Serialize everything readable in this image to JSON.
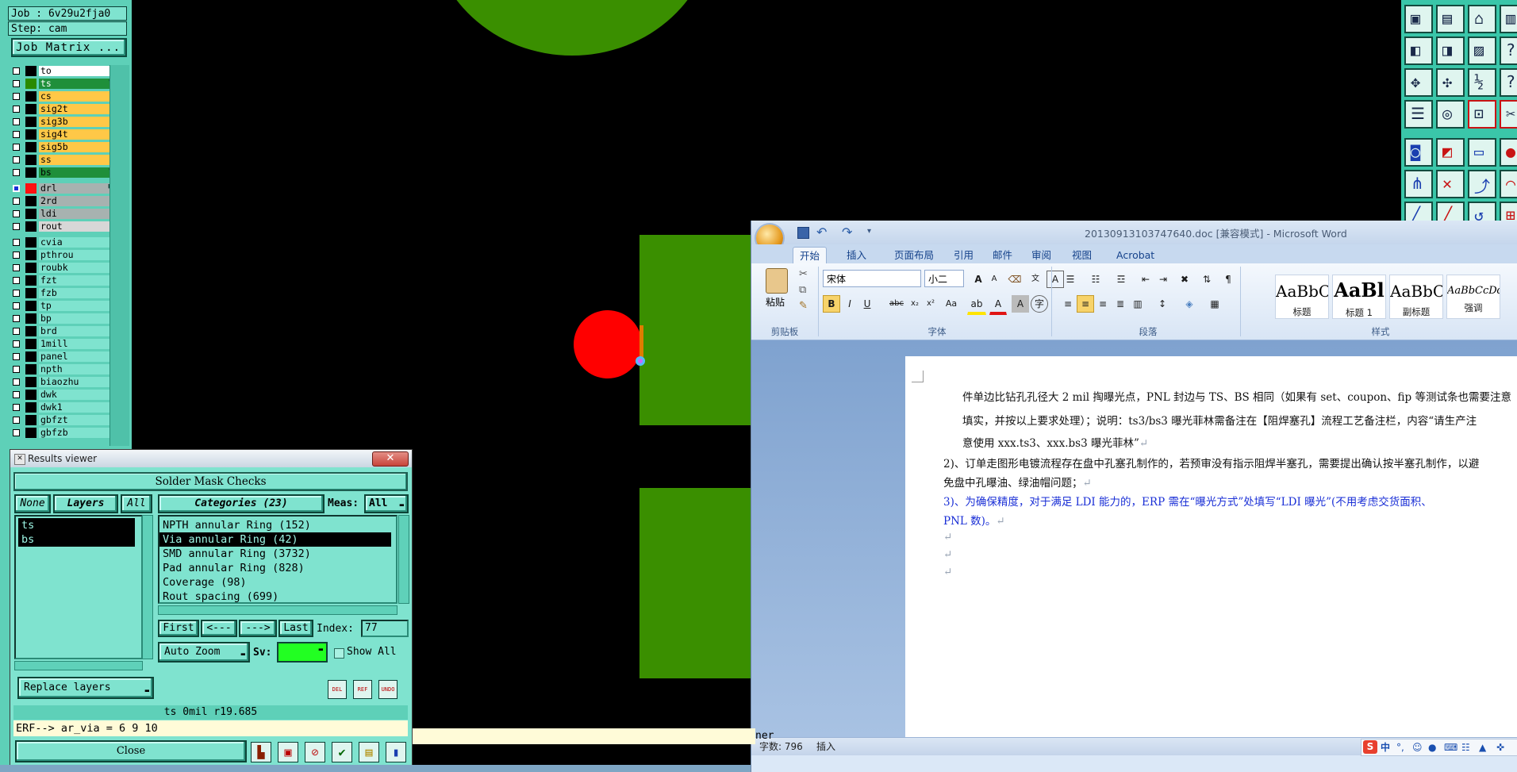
{
  "cam": {
    "job_label": "Job : 6v29u2fja0",
    "step_label": "Step: cam",
    "job_matrix_button": "Job Matrix ...",
    "layers": [
      {
        "name": "to",
        "color": "#ffffff",
        "swatch": "#000000"
      },
      {
        "name": "ts",
        "color": "#1f8f3a",
        "swatch": "#2a8a00",
        "active": true,
        "mark": "✎"
      },
      {
        "name": "cs",
        "color": "#ffc847",
        "swatch": "#000000"
      },
      {
        "name": "sig2t",
        "color": "#ffc847",
        "swatch": "#000000"
      },
      {
        "name": "sig3b",
        "color": "#ffc847",
        "swatch": "#000000"
      },
      {
        "name": "sig4t",
        "color": "#ffc847",
        "swatch": "#000000"
      },
      {
        "name": "sig5b",
        "color": "#ffc847",
        "swatch": "#000000"
      },
      {
        "name": "ss",
        "color": "#ffc847",
        "swatch": "#000000"
      },
      {
        "name": "bs",
        "color": "#1f8f3a",
        "swatch": "#000000",
        "mark": "✎"
      },
      {
        "name": "drl",
        "color": "#a7b2b0",
        "swatch": "#ff1111",
        "checked": true,
        "gap": true,
        "mark": "■"
      },
      {
        "name": "2rd",
        "color": "#a7b2b0",
        "swatch": "#000000"
      },
      {
        "name": "ldi",
        "color": "#a7b2b0",
        "swatch": "#000000"
      },
      {
        "name": "rout",
        "color": "#d7d7d7",
        "swatch": "#000000"
      },
      {
        "name": "cvia",
        "color": "#7fe3cf",
        "swatch": "#000000",
        "gap": true
      },
      {
        "name": "pthrou",
        "color": "#7fe3cf",
        "swatch": "#000000"
      },
      {
        "name": "roubk",
        "color": "#7fe3cf",
        "swatch": "#000000"
      },
      {
        "name": "fzt",
        "color": "#7fe3cf",
        "swatch": "#000000"
      },
      {
        "name": "fzb",
        "color": "#7fe3cf",
        "swatch": "#000000"
      },
      {
        "name": "tp",
        "color": "#7fe3cf",
        "swatch": "#000000"
      },
      {
        "name": "bp",
        "color": "#7fe3cf",
        "swatch": "#000000"
      },
      {
        "name": "brd",
        "color": "#7fe3cf",
        "swatch": "#000000"
      },
      {
        "name": "1mill",
        "color": "#7fe3cf",
        "swatch": "#000000"
      },
      {
        "name": "panel",
        "color": "#7fe3cf",
        "swatch": "#000000"
      },
      {
        "name": "npth",
        "color": "#7fe3cf",
        "swatch": "#000000"
      },
      {
        "name": "biaozhu",
        "color": "#7fe3cf",
        "swatch": "#000000"
      },
      {
        "name": "dwk",
        "color": "#7fe3cf",
        "swatch": "#000000"
      },
      {
        "name": "dwk1",
        "color": "#7fe3cf",
        "swatch": "#000000"
      },
      {
        "name": "gbfzt",
        "color": "#7fe3cf",
        "swatch": "#000000"
      },
      {
        "name": "gbfzb",
        "color": "#7fe3cf",
        "swatch": "#000000"
      }
    ],
    "status_text": "ts 0mil   r19.685",
    "command_line": "ERF--> ar_via = 6 9 10",
    "status_tail": "ner"
  },
  "results_viewer": {
    "window_title": "Results viewer",
    "close_x": "✕",
    "header": "Solder Mask Checks",
    "none_btn": "None",
    "layers_label": "Layers",
    "all_btn": "All",
    "categories_label": "Categories (23)",
    "meas_label": "Meas:",
    "meas_value": "All",
    "layer_items": [
      "ts",
      "bs"
    ],
    "category_items": [
      "NPTH annular Ring (152)",
      "Via annular Ring (42)",
      "SMD annular Ring (3732)",
      "Pad annular Ring (828)",
      "Coverage (98)",
      "Rout spacing (699)"
    ],
    "selected_category": 1,
    "first_btn": "First",
    "prev_btn": "<---",
    "next_btn": "--->",
    "last_btn": "Last",
    "index_label": "Index:",
    "index_value": "77",
    "auto_zoom": "Auto Zoom",
    "sv_label": "Sv:",
    "show_all_label": "Show All",
    "replace_layers": "Replace layers",
    "del_icon_text": "DEL",
    "ref_icon_text": "REF",
    "undo_icon_text": "UNDO",
    "close_btn": "Close"
  },
  "word": {
    "title": "20130913103747640.doc [兼容模式] - Microsoft Word",
    "tabs": [
      "开始",
      "插入",
      "页面布局",
      "引用",
      "邮件",
      "审阅",
      "视图",
      "Acrobat"
    ],
    "active_tab": 0,
    "paste_label": "粘贴",
    "font_name": "宋体",
    "font_size": "小二",
    "styles": [
      {
        "sample": "AaBbC",
        "name": "标题"
      },
      {
        "sample": "AaBl",
        "name": "标题 1"
      },
      {
        "sample": "AaBbC",
        "name": "副标题"
      },
      {
        "sample": "AaBbCcDd",
        "name": "强调"
      }
    ],
    "group_labels": [
      "剪贴板",
      "字体",
      "段落",
      "样式"
    ],
    "doc_lines": [
      "件单边比钻孔孔径大 2 mil 掏曝光点，PNL 封边与 TS、BS 相同（如果有 set、coupon、fip 等测试条也需要注意",
      "填实，并按以上要求处理）；说明：ts3/bs3 曝光菲林需备注在【阻焊塞孔】流程工艺备注栏，内容“请生产注",
      "意使用 xxx.ts3、xxx.bs3 曝光菲林”",
      "2)、订单走图形电镀流程存在盘中孔塞孔制作的，若预审没有指示阻焊半塞孔，需要提出确认按半塞孔制作，以避",
      "免盘中孔曝油、绿油帽问题；",
      "3)、为确保精度，对于满足 LDI 能力的，ERP 需在“曝光方式”处填写“LDI 曝光”(不用考虑交货面积、",
      "PNL 数)。"
    ],
    "para_mark": "↵",
    "word_count": "字数: 796",
    "insert_mode": "插入",
    "ime_text": "中"
  }
}
